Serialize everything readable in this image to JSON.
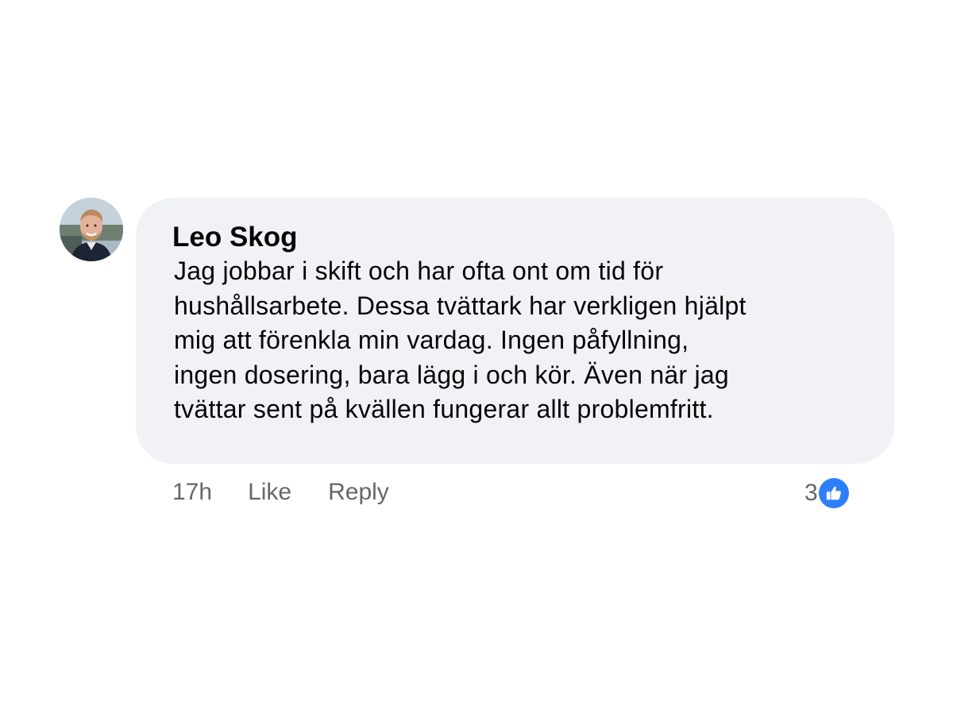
{
  "comment": {
    "author": "Leo Skog",
    "text_lines": [
      "Jag jobbar i skift och har ofta ont om tid för",
      "hushållsarbete. Dessa tvättark har verkligen hjälpt",
      "mig att förenkla min vardag. Ingen påfyllning,",
      "ingen dosering, bara lägg i och kör. Även när jag",
      "tvättar sent på kvällen fungerar allt problemfritt."
    ],
    "timestamp": "17h",
    "like_label": "Like",
    "reply_label": "Reply",
    "reaction_count": "3",
    "reaction_icon": "thumbs-up-icon"
  },
  "colors": {
    "bubble_background": "#f1f2f6",
    "text": "#050505",
    "secondary_text": "#65676b",
    "like_blue": "#2d7ff9"
  }
}
